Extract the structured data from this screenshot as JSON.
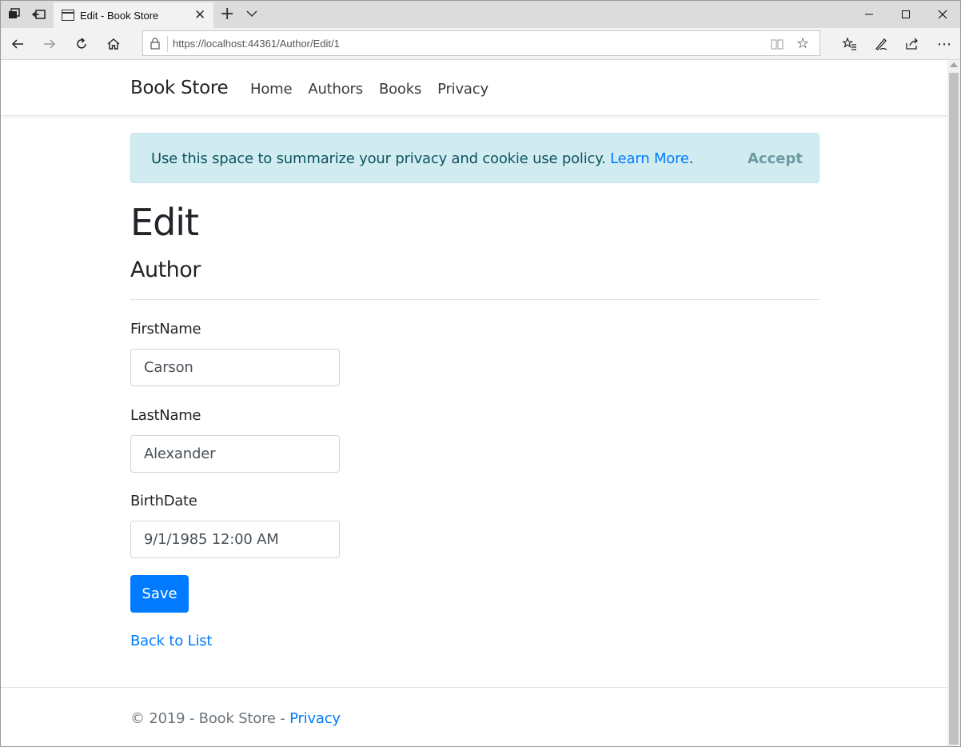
{
  "browser": {
    "tab_title": "Edit - Book Store",
    "tab_close": "✕",
    "new_tab": "+",
    "url_host": "https://localhost",
    "url_rest": ":44361/Author/Edit/1",
    "more_label": "⋯",
    "favorite_star": "☆"
  },
  "site": {
    "brand": "Book Store",
    "nav": [
      "Home",
      "Authors",
      "Books",
      "Privacy"
    ]
  },
  "cookie": {
    "message": "Use this space to summarize your privacy and cookie use policy.",
    "learn_more": "Learn More",
    "period": ".",
    "accept": "Accept"
  },
  "form": {
    "heading": "Edit",
    "subheading": "Author",
    "fields": [
      {
        "label": "FirstName",
        "value": "Carson"
      },
      {
        "label": "LastName",
        "value": "Alexander"
      },
      {
        "label": "BirthDate",
        "value": "9/1/1985 12:00 AM"
      }
    ],
    "save": "Save",
    "back": "Back to List"
  },
  "footer": {
    "text": "© 2019 - Book Store - ",
    "privacy": "Privacy"
  },
  "colors": {
    "primary": "#007bff",
    "alert_bg": "#d1ecf1",
    "alert_text": "#0c5460"
  }
}
